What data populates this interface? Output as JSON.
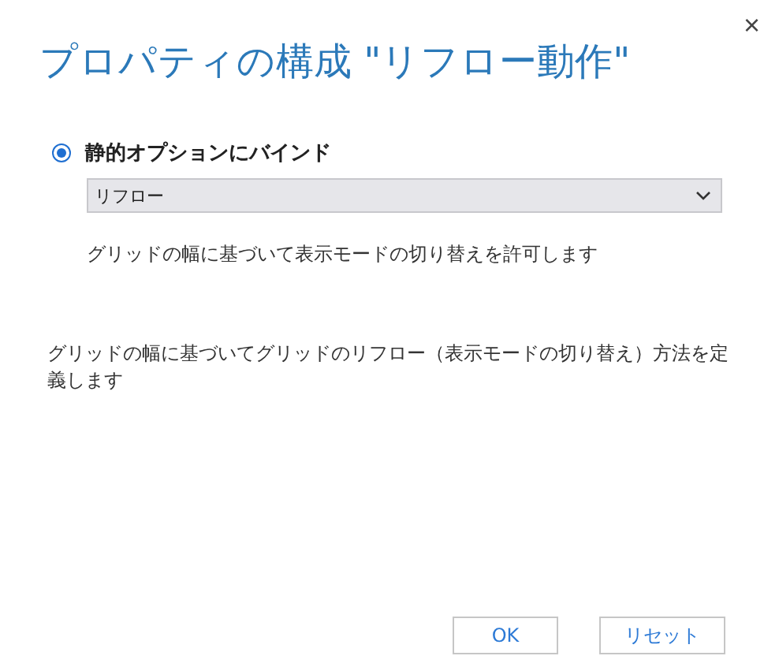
{
  "dialog": {
    "title": "プロパティの構成 \"リフロー動作\"",
    "close": "×"
  },
  "options": [
    {
      "kind": "radio",
      "label": "静的オプションにバインド",
      "selected": true
    }
  ],
  "dropdown": {
    "value": "リフロー"
  },
  "option_description": "グリッドの幅に基づいて表示モードの切り替えを許可します",
  "help_text": "グリッドの幅に基づいてグリッドのリフロー（表示モードの切り替え）方法を定義します",
  "buttons": [
    "OK",
    "リセット"
  ]
}
